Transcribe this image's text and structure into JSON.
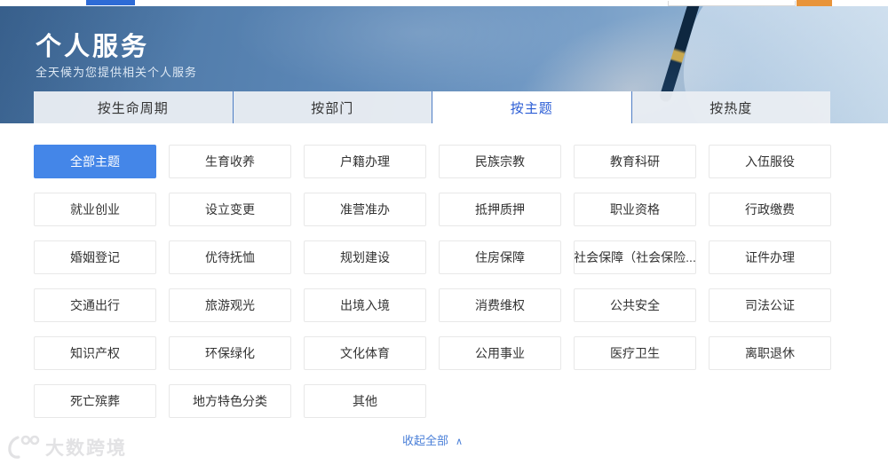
{
  "topbar": {
    "nav_underline_color": "#2e6bd6",
    "search_button_color": "#e8943a"
  },
  "header": {
    "title": "个人服务",
    "subtitle": "全天候为您提供相关个人服务"
  },
  "tabs": [
    {
      "name": "tab-by-lifecycle",
      "label": "按生命周期",
      "active": false
    },
    {
      "name": "tab-by-department",
      "label": "按部门",
      "active": false
    },
    {
      "name": "tab-by-theme",
      "label": "按主题",
      "active": true
    },
    {
      "name": "tab-by-popularity",
      "label": "按热度",
      "active": false
    }
  ],
  "topics": [
    {
      "name": "topic-all-topics",
      "label": "全部主题",
      "active": true
    },
    {
      "name": "topic-birth-adoption",
      "label": "生育收养",
      "active": false
    },
    {
      "name": "topic-household-registration",
      "label": "户籍办理",
      "active": false
    },
    {
      "name": "topic-ethnic-religion",
      "label": "民族宗教",
      "active": false
    },
    {
      "name": "topic-education-research",
      "label": "教育科研",
      "active": false
    },
    {
      "name": "topic-military-service",
      "label": "入伍服役",
      "active": false
    },
    {
      "name": "topic-employment-startup",
      "label": "就业创业",
      "active": false
    },
    {
      "name": "topic-establishment-change",
      "label": "设立变更",
      "active": false
    },
    {
      "name": "topic-business-licensing",
      "label": "准营准办",
      "active": false
    },
    {
      "name": "topic-mortgage-pledge",
      "label": "抵押质押",
      "active": false
    },
    {
      "name": "topic-professional-qualification",
      "label": "职业资格",
      "active": false
    },
    {
      "name": "topic-administrative-fees",
      "label": "行政缴费",
      "active": false
    },
    {
      "name": "topic-marriage-registration",
      "label": "婚姻登记",
      "active": false
    },
    {
      "name": "topic-preferential-support",
      "label": "优待抚恤",
      "active": false
    },
    {
      "name": "topic-planning-construction",
      "label": "规划建设",
      "active": false
    },
    {
      "name": "topic-housing-security",
      "label": "住房保障",
      "active": false
    },
    {
      "name": "topic-social-security",
      "label": "社会保障（社会保险...",
      "active": false
    },
    {
      "name": "topic-certificate-services",
      "label": "证件办理",
      "active": false
    },
    {
      "name": "topic-transportation",
      "label": "交通出行",
      "active": false
    },
    {
      "name": "topic-tourism",
      "label": "旅游观光",
      "active": false
    },
    {
      "name": "topic-entry-exit",
      "label": "出境入境",
      "active": false
    },
    {
      "name": "topic-consumer-rights",
      "label": "消费维权",
      "active": false
    },
    {
      "name": "topic-public-safety",
      "label": "公共安全",
      "active": false
    },
    {
      "name": "topic-judicial-notary",
      "label": "司法公证",
      "active": false
    },
    {
      "name": "topic-intellectual-property",
      "label": "知识产权",
      "active": false
    },
    {
      "name": "topic-environmental-protection",
      "label": "环保绿化",
      "active": false
    },
    {
      "name": "topic-culture-sports",
      "label": "文化体育",
      "active": false
    },
    {
      "name": "topic-public-utilities",
      "label": "公用事业",
      "active": false
    },
    {
      "name": "topic-medical-health",
      "label": "医疗卫生",
      "active": false
    },
    {
      "name": "topic-resignation-retirement",
      "label": "离职退休",
      "active": false
    },
    {
      "name": "topic-death-funeral",
      "label": "死亡殡葬",
      "active": false
    },
    {
      "name": "topic-local-special-category",
      "label": "地方特色分类",
      "active": false
    },
    {
      "name": "topic-other",
      "label": "其他",
      "active": false
    }
  ],
  "footer": {
    "collapse_label": "收起全部",
    "collapse_icon": "∧"
  },
  "watermark": {
    "text": "大数跨境"
  },
  "colors": {
    "accent_blue": "#4486e8",
    "tab_active_text": "#2a5cd5",
    "link_blue": "#4a7fd8",
    "banner_blue": "#5a85b4"
  }
}
